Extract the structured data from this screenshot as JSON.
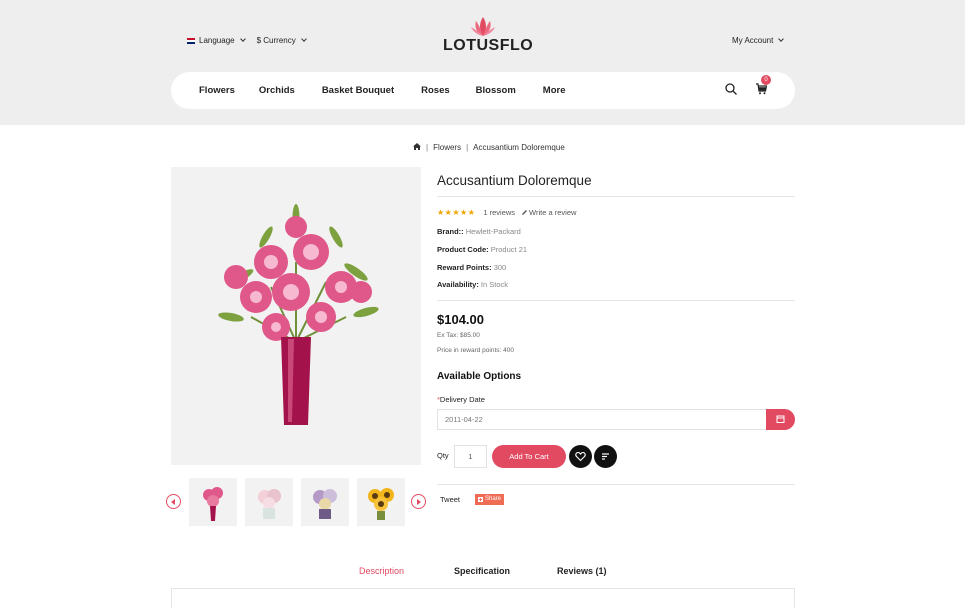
{
  "colors": {
    "accent": "#e24a61",
    "header_bg": "#eeeeee",
    "star": "#f0a500"
  },
  "topbar": {
    "language": "Language",
    "currency": "$ Currency",
    "account": "My Account"
  },
  "logo": {
    "text": "LOTUSFLO"
  },
  "nav": {
    "items": [
      "Flowers",
      "Orchids",
      "Basket Bouquet",
      "Roses",
      "Blossom",
      "More"
    ],
    "cart_count": "0"
  },
  "breadcrumb": {
    "items": [
      "Flowers",
      "Accusantium Doloremque"
    ]
  },
  "product": {
    "title": "Accusantium Doloremque",
    "stars": "★★★★★",
    "reviews": "1 reviews",
    "write_review": "Write a review",
    "brand_label": "Brand::",
    "brand": "Hewlett-Packard",
    "code_label": "Product Code:",
    "code": "Product 21",
    "points_label": "Reward Points:",
    "points": "300",
    "availability_label": "Availability:",
    "availability": "In Stock",
    "price": "$104.00",
    "ex_tax": "Ex Tax: $85.00",
    "reward_price": "Price in reward points: 400"
  },
  "options": {
    "heading": "Available Options",
    "required_mark": "*",
    "delivery_label": "Delivery Date",
    "delivery_value": "2011-04-22"
  },
  "cart": {
    "qty_label": "Qty",
    "qty_value": "1",
    "add_label": "Add To Cart"
  },
  "social": {
    "tweet": "Tweet",
    "share": "Share"
  },
  "tabs": [
    "Description",
    "Specification",
    "Reviews (1)"
  ]
}
